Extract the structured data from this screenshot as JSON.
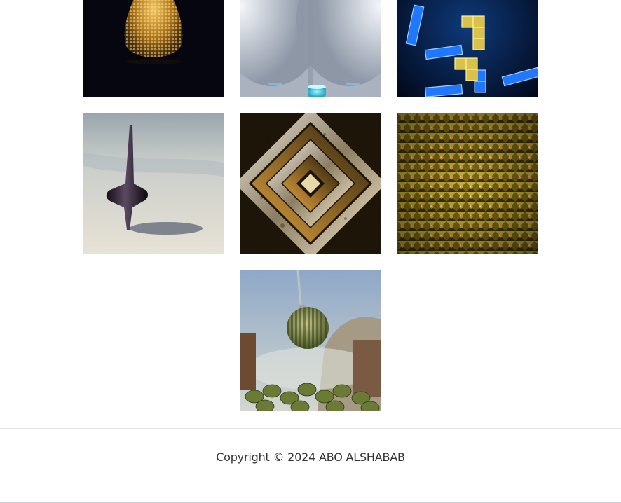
{
  "gallery": {
    "items": [
      {
        "name": "golden-beads-sphere-image"
      },
      {
        "name": "white-room-light-image"
      },
      {
        "name": "blue-tetris-blocks-image"
      },
      {
        "name": "spinning-top-image"
      },
      {
        "name": "metal-spiral-square-image"
      },
      {
        "name": "golden-cubes-spheres-image"
      },
      {
        "name": "watermelon-wrecking-ball-image"
      }
    ]
  },
  "footer": {
    "copyright": "Copyright © 2024 ABO ALSHABAB"
  },
  "colors": {
    "footer_text": "#333333",
    "divider": "#e2e2e2",
    "background": "#ffffff"
  }
}
